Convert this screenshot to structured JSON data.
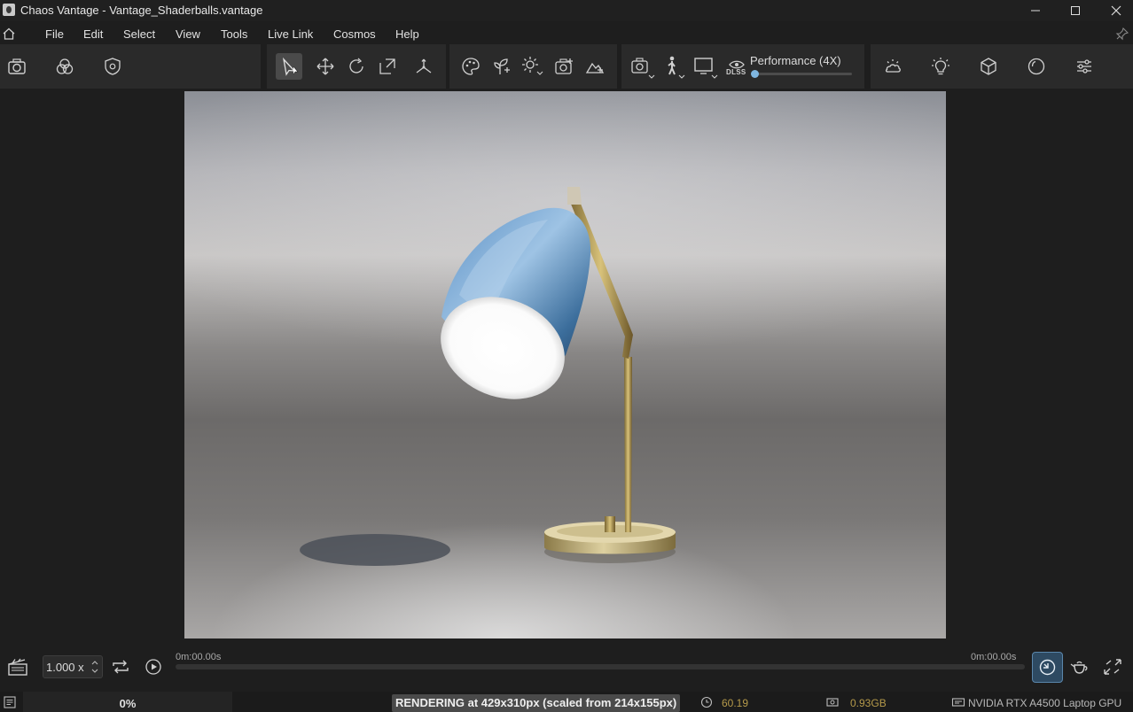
{
  "window": {
    "title": "Chaos Vantage - Vantage_Shaderballs.vantage",
    "controls": [
      "minimize-icon",
      "maximize-icon",
      "close-icon"
    ]
  },
  "menu": {
    "items": [
      "File",
      "Edit",
      "Select",
      "View",
      "Tools",
      "Live Link",
      "Cosmos",
      "Help"
    ]
  },
  "toolbar": {
    "left_tools": [
      "camera-icon",
      "color-balance-icon",
      "shield-gear-icon"
    ],
    "transform_tools": [
      "select-arrow-icon",
      "move-icon",
      "rotate-icon",
      "scale-icon",
      "pivot-icon"
    ],
    "asset_tools": [
      "palette-icon",
      "add-plant-icon",
      "add-light-icon",
      "add-camera-icon",
      "add-terrain-icon"
    ],
    "view_tools": [
      "camera-mode-icon",
      "walk-mode-icon",
      "display-icon"
    ],
    "performance": {
      "label": "Performance (4X)",
      "badge": "DLSS",
      "level": 0.03
    },
    "right_tools": [
      "environment-icon",
      "light-bulb-icon",
      "cube-icon",
      "sphere-icon",
      "settings-sliders-icon"
    ],
    "accent_color": "#6aa8d6"
  },
  "timeline": {
    "speed": "1.000 x",
    "start_time": "0m:00.00s",
    "end_time": "0m:00.00s",
    "tools": [
      "clapperboard-icon",
      "loop-icon",
      "play-icon",
      "sync-icon",
      "teapot-icon",
      "expand-icon"
    ]
  },
  "status": {
    "progress": "0%",
    "rendering": "RENDERING at 429x310px (scaled from 214x155px)",
    "fps": "60.19",
    "memory": "0.93GB",
    "gpu": "NVIDIA RTX A4500 Laptop GPU",
    "stat_color": "#b59a4a"
  }
}
